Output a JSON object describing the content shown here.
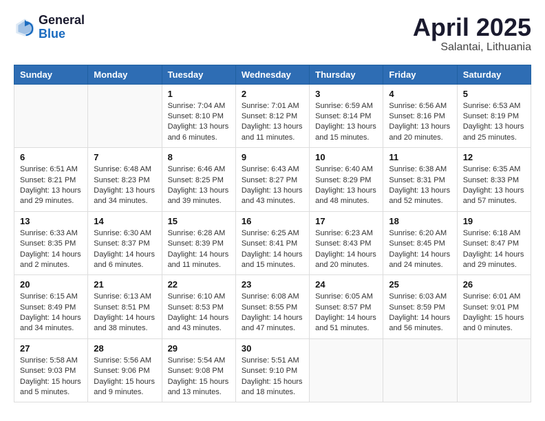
{
  "header": {
    "logo_general": "General",
    "logo_blue": "Blue",
    "month_title": "April 2025",
    "location": "Salantai, Lithuania"
  },
  "weekdays": [
    "Sunday",
    "Monday",
    "Tuesday",
    "Wednesday",
    "Thursday",
    "Friday",
    "Saturday"
  ],
  "weeks": [
    [
      {
        "day": "",
        "info": ""
      },
      {
        "day": "",
        "info": ""
      },
      {
        "day": "1",
        "info": "Sunrise: 7:04 AM\nSunset: 8:10 PM\nDaylight: 13 hours\nand 6 minutes."
      },
      {
        "day": "2",
        "info": "Sunrise: 7:01 AM\nSunset: 8:12 PM\nDaylight: 13 hours\nand 11 minutes."
      },
      {
        "day": "3",
        "info": "Sunrise: 6:59 AM\nSunset: 8:14 PM\nDaylight: 13 hours\nand 15 minutes."
      },
      {
        "day": "4",
        "info": "Sunrise: 6:56 AM\nSunset: 8:16 PM\nDaylight: 13 hours\nand 20 minutes."
      },
      {
        "day": "5",
        "info": "Sunrise: 6:53 AM\nSunset: 8:19 PM\nDaylight: 13 hours\nand 25 minutes."
      }
    ],
    [
      {
        "day": "6",
        "info": "Sunrise: 6:51 AM\nSunset: 8:21 PM\nDaylight: 13 hours\nand 29 minutes."
      },
      {
        "day": "7",
        "info": "Sunrise: 6:48 AM\nSunset: 8:23 PM\nDaylight: 13 hours\nand 34 minutes."
      },
      {
        "day": "8",
        "info": "Sunrise: 6:46 AM\nSunset: 8:25 PM\nDaylight: 13 hours\nand 39 minutes."
      },
      {
        "day": "9",
        "info": "Sunrise: 6:43 AM\nSunset: 8:27 PM\nDaylight: 13 hours\nand 43 minutes."
      },
      {
        "day": "10",
        "info": "Sunrise: 6:40 AM\nSunset: 8:29 PM\nDaylight: 13 hours\nand 48 minutes."
      },
      {
        "day": "11",
        "info": "Sunrise: 6:38 AM\nSunset: 8:31 PM\nDaylight: 13 hours\nand 52 minutes."
      },
      {
        "day": "12",
        "info": "Sunrise: 6:35 AM\nSunset: 8:33 PM\nDaylight: 13 hours\nand 57 minutes."
      }
    ],
    [
      {
        "day": "13",
        "info": "Sunrise: 6:33 AM\nSunset: 8:35 PM\nDaylight: 14 hours\nand 2 minutes."
      },
      {
        "day": "14",
        "info": "Sunrise: 6:30 AM\nSunset: 8:37 PM\nDaylight: 14 hours\nand 6 minutes."
      },
      {
        "day": "15",
        "info": "Sunrise: 6:28 AM\nSunset: 8:39 PM\nDaylight: 14 hours\nand 11 minutes."
      },
      {
        "day": "16",
        "info": "Sunrise: 6:25 AM\nSunset: 8:41 PM\nDaylight: 14 hours\nand 15 minutes."
      },
      {
        "day": "17",
        "info": "Sunrise: 6:23 AM\nSunset: 8:43 PM\nDaylight: 14 hours\nand 20 minutes."
      },
      {
        "day": "18",
        "info": "Sunrise: 6:20 AM\nSunset: 8:45 PM\nDaylight: 14 hours\nand 24 minutes."
      },
      {
        "day": "19",
        "info": "Sunrise: 6:18 AM\nSunset: 8:47 PM\nDaylight: 14 hours\nand 29 minutes."
      }
    ],
    [
      {
        "day": "20",
        "info": "Sunrise: 6:15 AM\nSunset: 8:49 PM\nDaylight: 14 hours\nand 34 minutes."
      },
      {
        "day": "21",
        "info": "Sunrise: 6:13 AM\nSunset: 8:51 PM\nDaylight: 14 hours\nand 38 minutes."
      },
      {
        "day": "22",
        "info": "Sunrise: 6:10 AM\nSunset: 8:53 PM\nDaylight: 14 hours\nand 43 minutes."
      },
      {
        "day": "23",
        "info": "Sunrise: 6:08 AM\nSunset: 8:55 PM\nDaylight: 14 hours\nand 47 minutes."
      },
      {
        "day": "24",
        "info": "Sunrise: 6:05 AM\nSunset: 8:57 PM\nDaylight: 14 hours\nand 51 minutes."
      },
      {
        "day": "25",
        "info": "Sunrise: 6:03 AM\nSunset: 8:59 PM\nDaylight: 14 hours\nand 56 minutes."
      },
      {
        "day": "26",
        "info": "Sunrise: 6:01 AM\nSunset: 9:01 PM\nDaylight: 15 hours\nand 0 minutes."
      }
    ],
    [
      {
        "day": "27",
        "info": "Sunrise: 5:58 AM\nSunset: 9:03 PM\nDaylight: 15 hours\nand 5 minutes."
      },
      {
        "day": "28",
        "info": "Sunrise: 5:56 AM\nSunset: 9:06 PM\nDaylight: 15 hours\nand 9 minutes."
      },
      {
        "day": "29",
        "info": "Sunrise: 5:54 AM\nSunset: 9:08 PM\nDaylight: 15 hours\nand 13 minutes."
      },
      {
        "day": "30",
        "info": "Sunrise: 5:51 AM\nSunset: 9:10 PM\nDaylight: 15 hours\nand 18 minutes."
      },
      {
        "day": "",
        "info": ""
      },
      {
        "day": "",
        "info": ""
      },
      {
        "day": "",
        "info": ""
      }
    ]
  ]
}
